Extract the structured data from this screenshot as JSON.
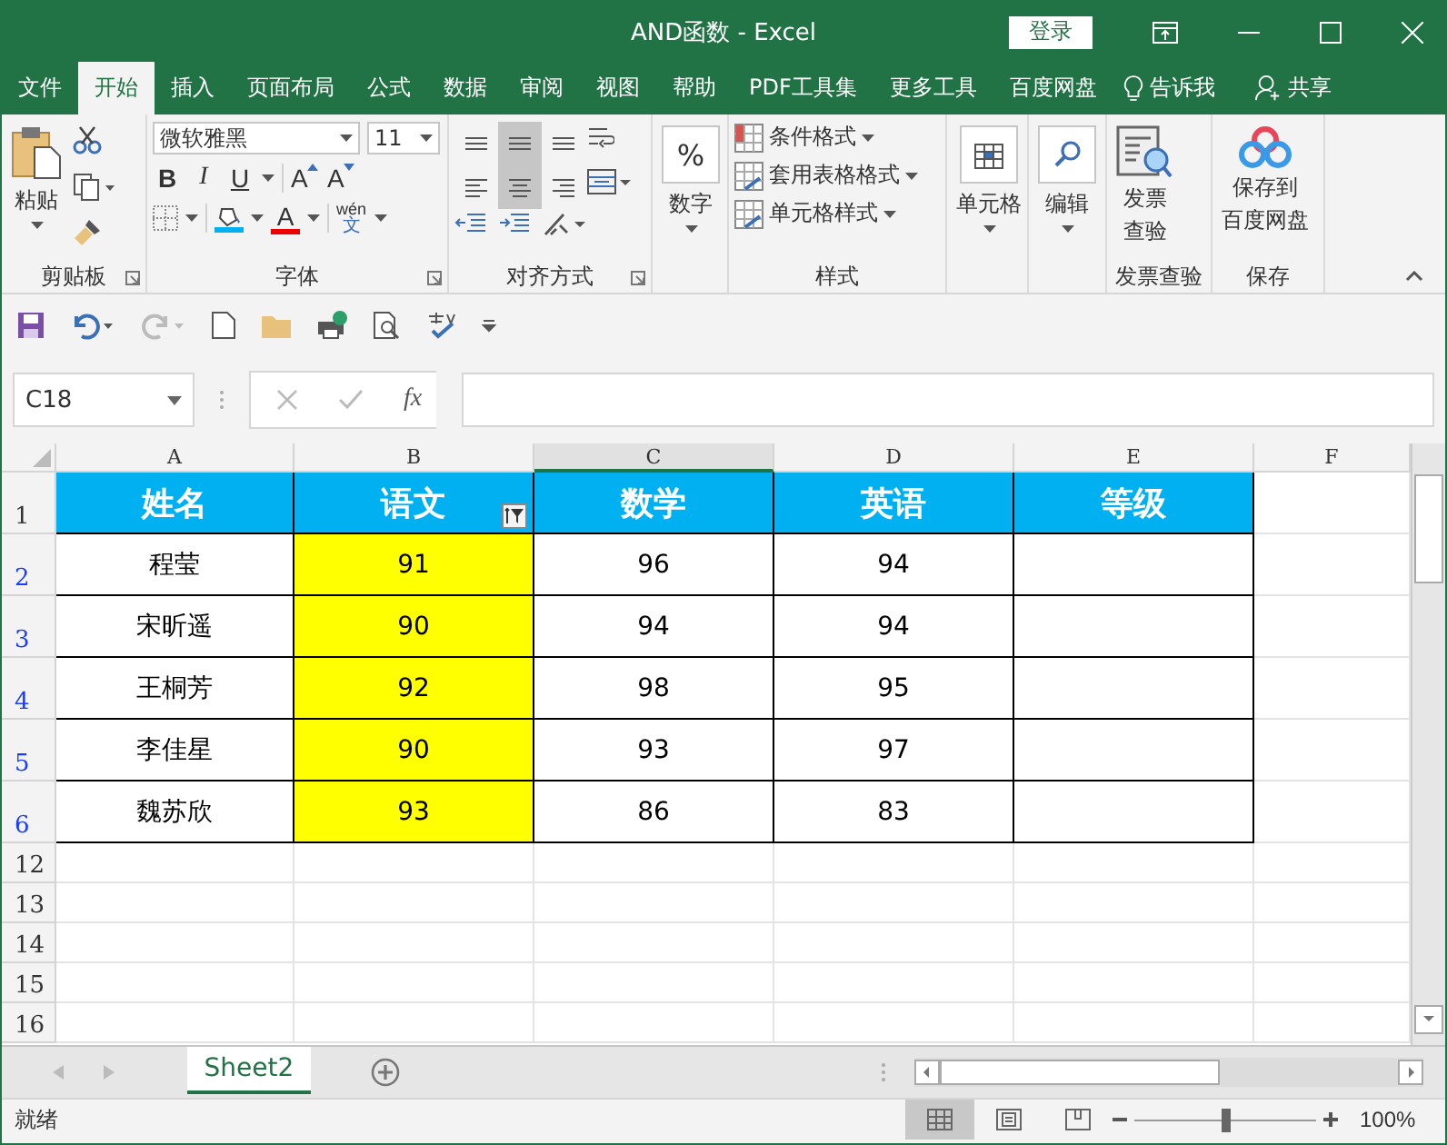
{
  "window": {
    "title": "AND函数 - Excel",
    "login": "登录"
  },
  "tabs": [
    {
      "label": "文件",
      "selected": false
    },
    {
      "label": "开始",
      "selected": true
    },
    {
      "label": "插入",
      "selected": false
    },
    {
      "label": "页面布局",
      "selected": false
    },
    {
      "label": "公式",
      "selected": false
    },
    {
      "label": "数据",
      "selected": false
    },
    {
      "label": "审阅",
      "selected": false
    },
    {
      "label": "视图",
      "selected": false
    },
    {
      "label": "帮助",
      "selected": false
    },
    {
      "label": "PDF工具集",
      "selected": false
    },
    {
      "label": "更多工具",
      "selected": false
    },
    {
      "label": "百度网盘",
      "selected": false
    }
  ],
  "tell_me": "告诉我",
  "share": "共享",
  "ribbon": {
    "clipboard": {
      "label": "剪贴板",
      "paste": "粘贴"
    },
    "font": {
      "label": "字体",
      "name": "微软雅黑",
      "size": "11",
      "styles": [
        "B",
        "I",
        "U"
      ],
      "grow": "A",
      "shrink": "A",
      "color_letter": "A",
      "phonetic_top": "wén",
      "phonetic_bottom": "文"
    },
    "alignment": {
      "label": "对齐方式",
      "buttons": [
        {
          "kind": "top",
          "selected": false
        },
        {
          "kind": "middle",
          "selected": true
        },
        {
          "kind": "bottom",
          "selected": false
        },
        {
          "kind": "left",
          "selected": false
        },
        {
          "kind": "center",
          "selected": true
        },
        {
          "kind": "right",
          "selected": false
        }
      ]
    },
    "number": {
      "label": "数字",
      "symbol": "%"
    },
    "styles": {
      "label": "样式",
      "items": [
        "条件格式",
        "套用表格格式",
        "单元格样式"
      ]
    },
    "cells": {
      "label": "单元格"
    },
    "editing": {
      "label": "编辑"
    },
    "invoice": {
      "button_lines": [
        "发票",
        "查验"
      ],
      "label": "发票查验"
    },
    "save": {
      "button_lines": [
        "保存到",
        "百度网盘"
      ],
      "label": "保存"
    }
  },
  "formula_bar": {
    "name_box": "C18",
    "fx": "fx"
  },
  "sheet": {
    "columns": [
      {
        "label": "A",
        "active": false
      },
      {
        "label": "B",
        "active": false
      },
      {
        "label": "C",
        "active": true
      },
      {
        "label": "D",
        "active": false
      },
      {
        "label": "E",
        "active": false
      },
      {
        "label": "F",
        "active": false
      }
    ],
    "rows": [
      {
        "number": "1",
        "filtered": false,
        "kind": "header",
        "cells": [
          {
            "text": "姓名",
            "filter": false
          },
          {
            "text": "语文",
            "filter": true
          },
          {
            "text": "数学",
            "filter": false
          },
          {
            "text": "英语",
            "filter": false
          },
          {
            "text": "等级",
            "filter": false
          }
        ]
      },
      {
        "number": "2",
        "filtered": true,
        "kind": "data",
        "cells": [
          {
            "text": "程莹",
            "highlighted": false
          },
          {
            "text": "91",
            "highlighted": true
          },
          {
            "text": "96",
            "highlighted": false
          },
          {
            "text": "94",
            "highlighted": false
          }
        ]
      },
      {
        "number": "3",
        "filtered": true,
        "kind": "data",
        "cells": [
          {
            "text": "宋昕遥",
            "highlighted": false
          },
          {
            "text": "90",
            "highlighted": true
          },
          {
            "text": "94",
            "highlighted": false
          },
          {
            "text": "94",
            "highlighted": false
          }
        ]
      },
      {
        "number": "4",
        "filtered": true,
        "kind": "data",
        "cells": [
          {
            "text": "王桐芳",
            "highlighted": false
          },
          {
            "text": "92",
            "highlighted": true
          },
          {
            "text": "98",
            "highlighted": false
          },
          {
            "text": "95",
            "highlighted": false
          }
        ]
      },
      {
        "number": "5",
        "filtered": true,
        "kind": "data",
        "cells": [
          {
            "text": "李佳星",
            "highlighted": false
          },
          {
            "text": "90",
            "highlighted": true
          },
          {
            "text": "93",
            "highlighted": false
          },
          {
            "text": "97",
            "highlighted": false
          }
        ]
      },
      {
        "number": "6",
        "filtered": true,
        "kind": "data",
        "cells": [
          {
            "text": "魏苏欣",
            "highlighted": false
          },
          {
            "text": "93",
            "highlighted": true
          },
          {
            "text": "86",
            "highlighted": false
          },
          {
            "text": "83",
            "highlighted": false
          }
        ]
      },
      {
        "number": "12",
        "filtered": false,
        "kind": "blank"
      },
      {
        "number": "13",
        "filtered": false,
        "kind": "blank"
      },
      {
        "number": "14",
        "filtered": false,
        "kind": "blank"
      },
      {
        "number": "15",
        "filtered": false,
        "kind": "blank"
      },
      {
        "number": "16",
        "filtered": false,
        "kind": "blank"
      }
    ]
  },
  "sheet_tabs": [
    {
      "label": "Sheet2",
      "selected": true
    }
  ],
  "status_bar": {
    "status": "就绪",
    "views": [
      {
        "kind": "normal",
        "selected": true
      },
      {
        "kind": "page_layout",
        "selected": false
      },
      {
        "kind": "page_break",
        "selected": false
      }
    ],
    "zoom": {
      "level": 0.5,
      "reading": "100%"
    }
  }
}
